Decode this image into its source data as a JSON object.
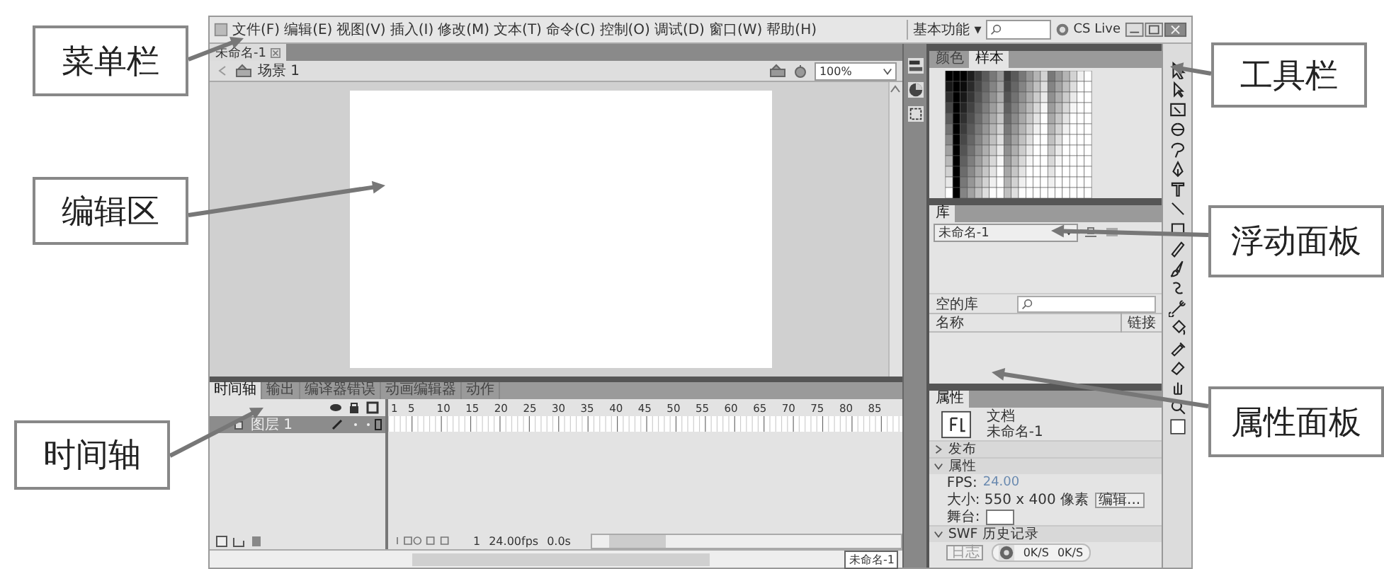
{
  "callouts": [
    {
      "text": "菜单栏"
    },
    {
      "text": "编辑区"
    },
    {
      "text": "时间轴"
    },
    {
      "text": "工具栏"
    },
    {
      "text": "浮动面板"
    },
    {
      "text": "属性面板"
    }
  ],
  "menu": {
    "items": [
      "文件(F)",
      "编辑(E)",
      "视图(V)",
      "插入(I)",
      "修改(M)",
      "文本(T)",
      "命令(C)",
      "控制(O)",
      "调试(D)",
      "窗口(W)",
      "帮助(H)"
    ],
    "workspace": "基本功能 ▾",
    "service": "CS Live"
  },
  "document": {
    "tab": "未命名-1",
    "scene": "场景 1",
    "zoom": "100%",
    "bottom_tab": "未命名-1"
  },
  "timeline": {
    "tabs": [
      {
        "label": "时间轴",
        "selected": true
      },
      {
        "label": "输出",
        "selected": false
      },
      {
        "label": "编译器错误",
        "selected": false
      },
      {
        "label": "动画编辑器",
        "selected": false
      },
      {
        "label": "动作",
        "selected": false
      }
    ],
    "frame_numbers": [
      "1",
      "5",
      "10",
      "15",
      "20",
      "25",
      "30",
      "35",
      "40",
      "45",
      "50",
      "55",
      "60",
      "65",
      "70",
      "75",
      "80",
      "85"
    ],
    "layers": [
      {
        "name": "图层 1",
        "selected": true
      }
    ],
    "current_frame": "1",
    "fps": "24.00fps",
    "time": "0.0s"
  },
  "color_panel": {
    "tabs": [
      {
        "label": "颜色",
        "selected": false
      },
      {
        "label": "样本",
        "selected": true
      }
    ]
  },
  "library": {
    "title": "库",
    "document": "未命名-1",
    "search_label": "空的库",
    "columns": [
      "名称",
      "链接"
    ]
  },
  "properties": {
    "title": "属性",
    "type": "文档",
    "name": "未命名-1",
    "sections": [
      {
        "label": "发布",
        "expanded": false
      },
      {
        "label": "属性",
        "expanded": true
      },
      {
        "label": "SWF 历史记录",
        "expanded": true
      }
    ],
    "fps_label": "FPS:",
    "fps": "24.00",
    "size": "大小: 550 x 400 像素",
    "edit_button": "编辑...",
    "stage_label": "舞台:",
    "log_button": "日志",
    "rate_in": "0K/S",
    "rate_out": "0K/S"
  }
}
